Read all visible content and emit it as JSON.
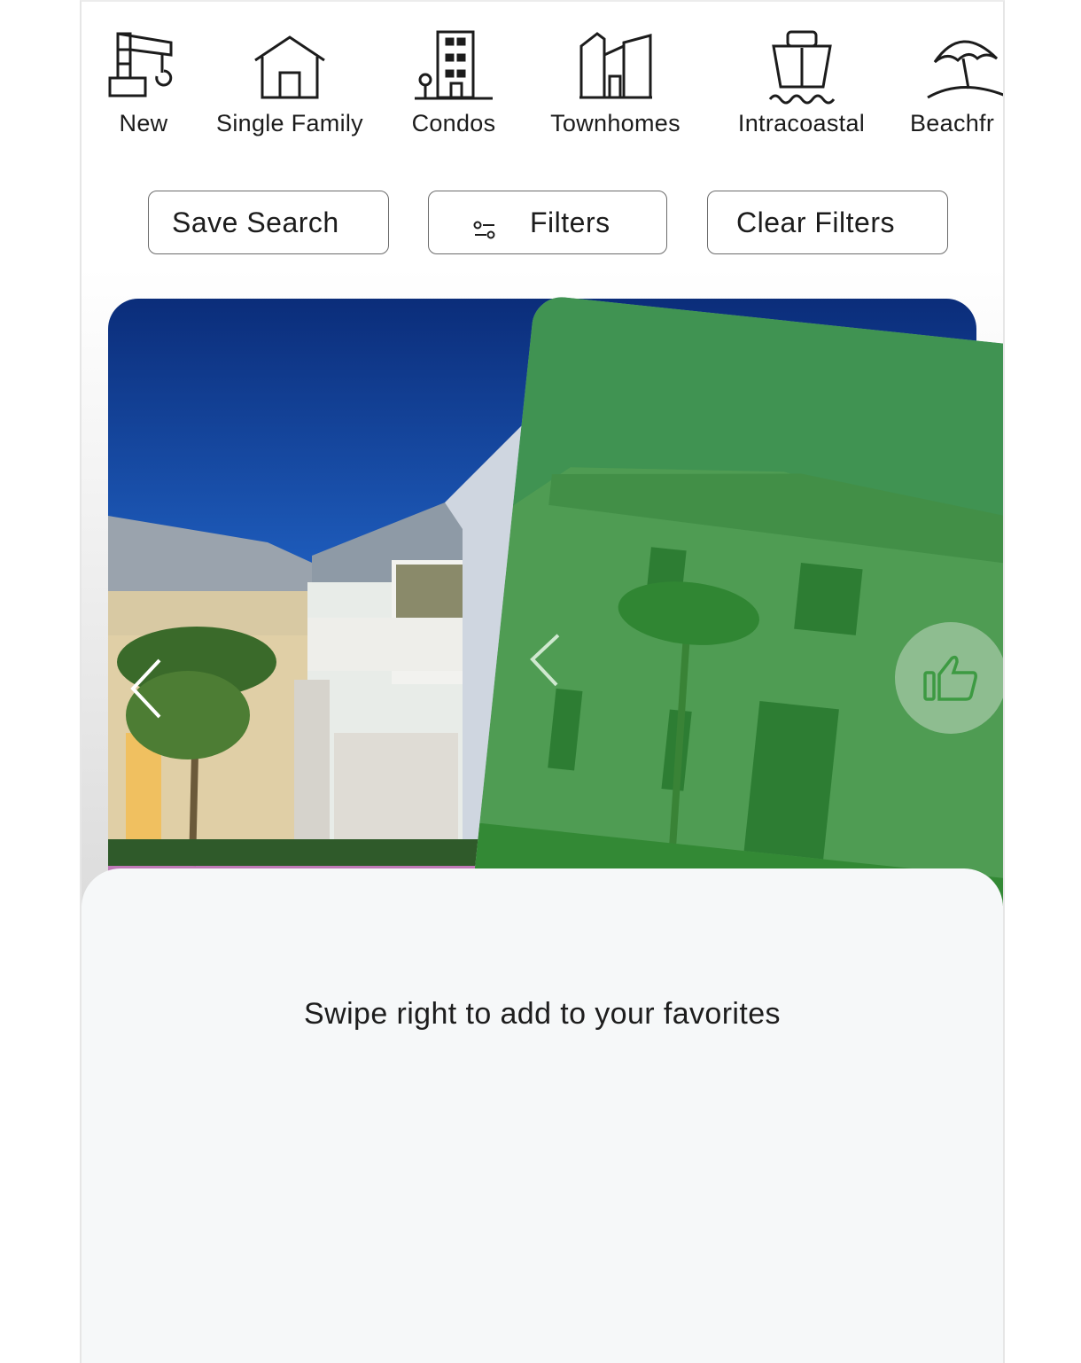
{
  "categories": [
    {
      "label": "New",
      "icon": "crane-icon"
    },
    {
      "label": "Single Family",
      "icon": "house-icon"
    },
    {
      "label": "Condos",
      "icon": "condo-building-icon"
    },
    {
      "label": "Townhomes",
      "icon": "townhomes-icon"
    },
    {
      "label": "Intracoastal",
      "icon": "boat-icon"
    },
    {
      "label": "Beachfr",
      "icon": "beach-umbrella-icon"
    }
  ],
  "actions": {
    "save_search": "Save Search",
    "filters": "Filters",
    "clear_filters": "Clear Filters"
  },
  "hint": "Swipe right to add to your favorites",
  "colors": {
    "like_overlay": "#2e8c36",
    "sheet_bg": "#f6f8f9",
    "button_border": "#6c6c6c"
  },
  "icons": {
    "prev": "chevron-left-icon",
    "like": "thumbs-up-icon",
    "filters": "sliders-icon"
  }
}
